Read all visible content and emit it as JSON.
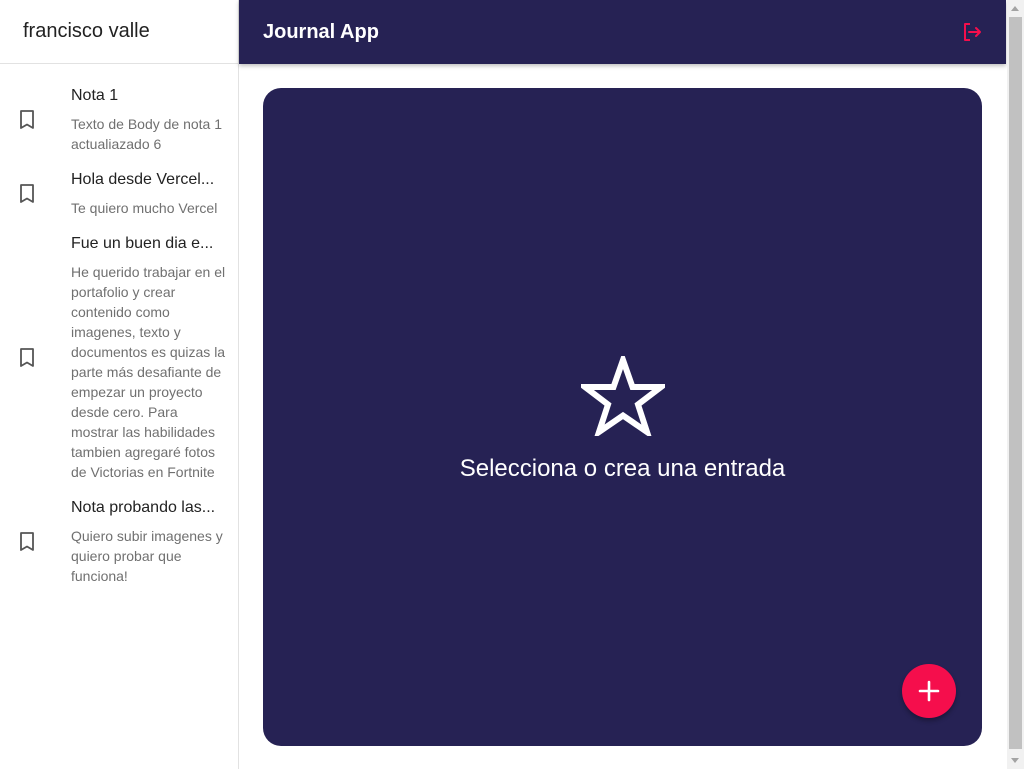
{
  "sidebar": {
    "user_name": "francisco valle",
    "notes": [
      {
        "title": "Nota 1",
        "body": "Texto de Body de nota 1 actualiazado 6",
        "icon": "bookmark-outline-icon"
      },
      {
        "title": "Hola desde Vercel...",
        "body": "Te quiero mucho Vercel",
        "icon": "bookmark-outline-icon"
      },
      {
        "title": "Fue un buen dia e...",
        "body": "He querido trabajar en el portafolio y crear contenido como imagenes, texto y documentos es quizas la parte más desafiante de empezar un proyecto desde cero. Para mostrar las habilidades tambien agregaré fotos de Victorias en Fortnite",
        "icon": "bookmark-outline-icon"
      },
      {
        "title": "Nota probando las...",
        "body": "Quiero subir imagenes y quiero probar que funciona!",
        "icon": "bookmark-outline-icon"
      }
    ]
  },
  "appbar": {
    "title": "Journal App",
    "logout_icon": "logout-icon"
  },
  "main": {
    "empty_icon": "star-outline-icon",
    "empty_message": "Selecciona o crea una entrada",
    "fab_icon": "plus-icon"
  },
  "colors": {
    "primary": "#262254",
    "accent": "#f50e4c",
    "sidebar_bg": "#ffffff"
  }
}
